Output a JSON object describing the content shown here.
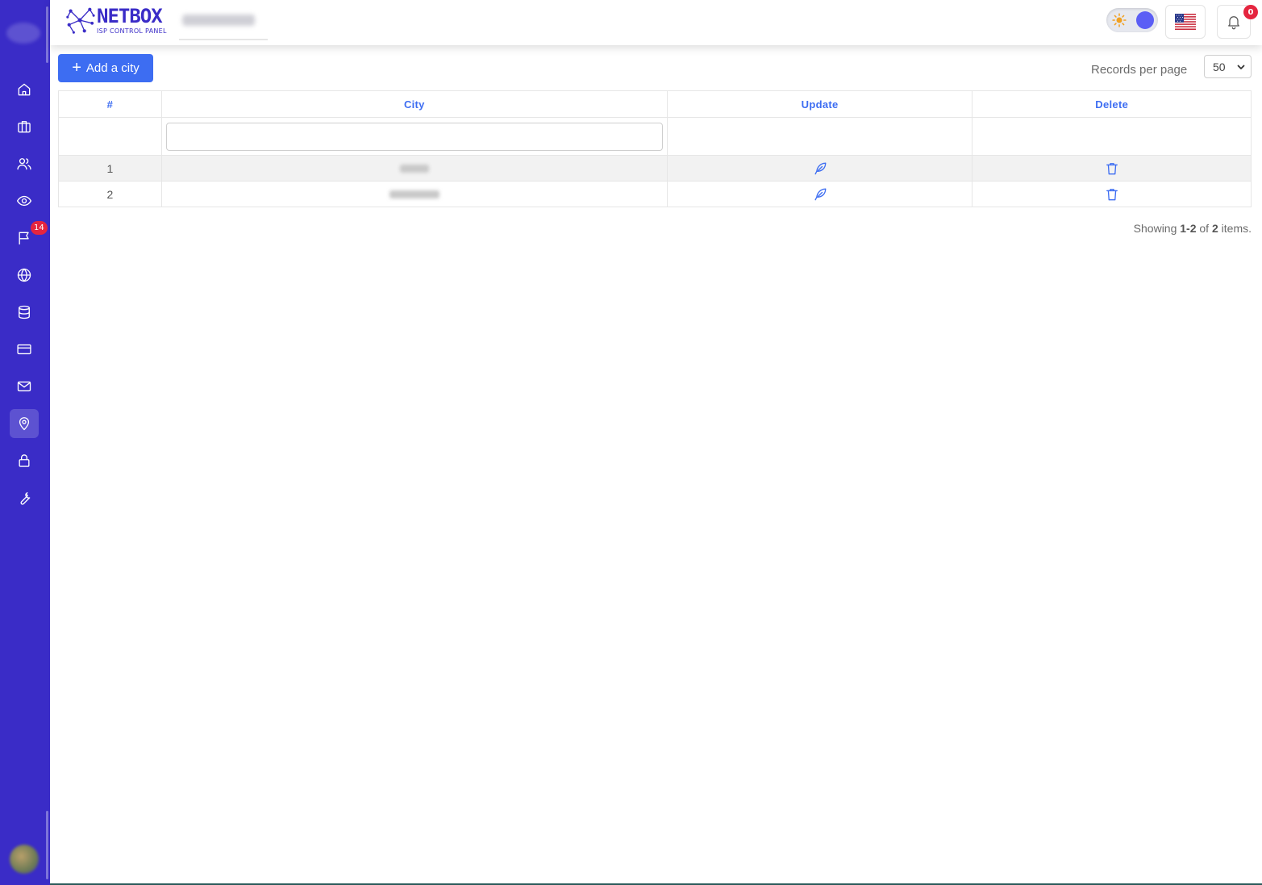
{
  "brand": {
    "name": "NETBOX",
    "subtitle": "ISP CONTROL PANEL"
  },
  "sidebar": {
    "items": [
      {
        "icon": "home-icon"
      },
      {
        "icon": "briefcase-icon"
      },
      {
        "icon": "users-icon"
      },
      {
        "icon": "eye-icon"
      },
      {
        "icon": "flag-icon",
        "badge": "14"
      },
      {
        "icon": "globe-icon"
      },
      {
        "icon": "database-icon"
      },
      {
        "icon": "credit-card-icon"
      },
      {
        "icon": "mail-icon"
      },
      {
        "icon": "map-pin-icon",
        "active": true
      },
      {
        "icon": "lock-icon"
      },
      {
        "icon": "wrench-icon"
      }
    ]
  },
  "header": {
    "notifications_count": "0"
  },
  "toolbar": {
    "add_label": "Add a city",
    "records_per_page_label": "Records per page",
    "records_per_page_value": "50"
  },
  "table": {
    "columns": [
      "#",
      "City",
      "Update",
      "Delete"
    ],
    "rows": [
      {
        "index": "1"
      },
      {
        "index": "2"
      }
    ]
  },
  "summary": {
    "prefix": "Showing",
    "range": "1-2",
    "of": "of",
    "total": "2",
    "suffix": "items."
  },
  "colors": {
    "sidebar": "#3a2cc7",
    "primary": "#3d6df2",
    "badge": "#e5253f"
  }
}
